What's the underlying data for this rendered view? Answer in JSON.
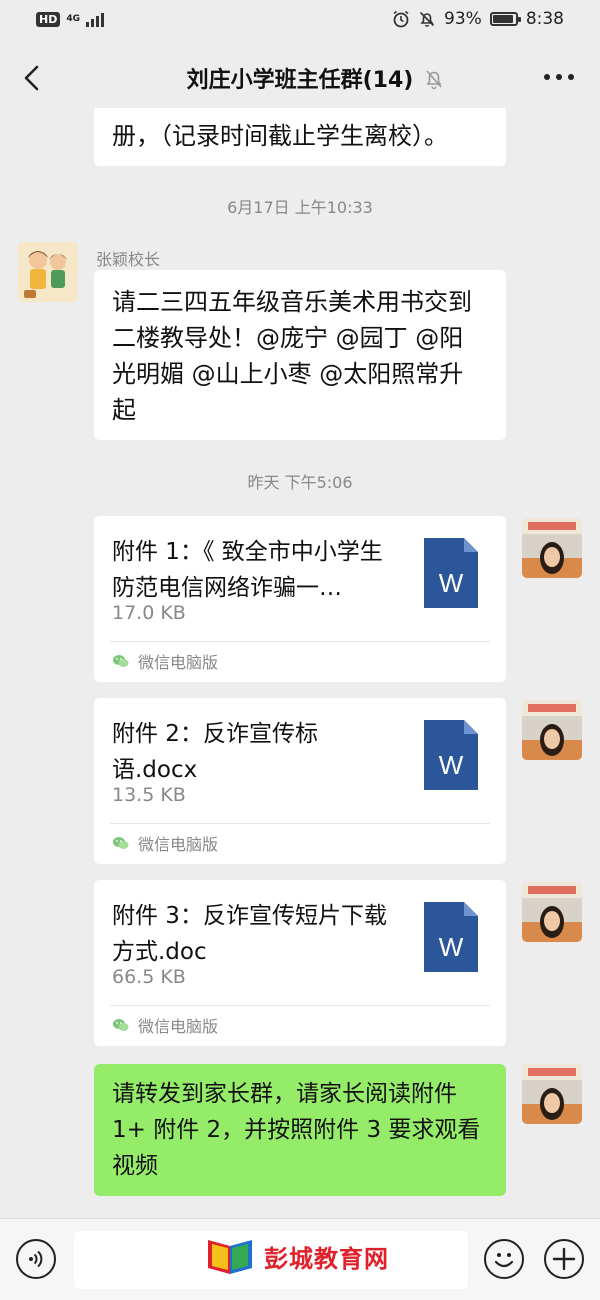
{
  "status_bar": {
    "hd_label": "HD",
    "network_label": "4G",
    "battery": "93%",
    "battery_level": 0.93,
    "time": "8:38",
    "icons": [
      "alarm-icon",
      "do-not-disturb-icon",
      "battery-icon",
      "signal-icon"
    ]
  },
  "header": {
    "title": "刘庄小学班主任群(14)",
    "back_icon": "chevron-left-icon",
    "mute_icon": "bell-off-icon",
    "more_icon": "more-dots-icon"
  },
  "messages": {
    "prev_tail": "册，（记录时间截止学生离校）。",
    "time1": "6月17日 上午10:33",
    "sender1": "张颖校长",
    "msg1_lines": [
      "请二三四五年级音乐美术用书交到",
      "二楼教导处！@庞宁 @园丁 @阳",
      "光明媚 @山上小枣 @太阳照常升",
      "起"
    ],
    "time2": "昨天 下午5:06",
    "files": [
      {
        "name": "附件 1：《 致全市中小学生防范电信网络诈骗一…",
        "size": "17.0 KB",
        "source": "微信电脑版",
        "icon_label": "W"
      },
      {
        "name": "附件 2：反诈宣传标语.docx",
        "size": "13.5 KB",
        "source": "微信电脑版",
        "icon_label": "W"
      },
      {
        "name": "附件 3：反诈宣传短片下载方式.doc",
        "size": "66.5 KB",
        "source": "微信电脑版",
        "icon_label": "W"
      }
    ],
    "last_msg_lines": [
      "请转发到家长群，请家长阅读附件",
      "1+ 附件 2，并按照附件 3 要求观看",
      "视频"
    ]
  },
  "input_bar": {
    "voice_icon": "voice-icon",
    "emoji_icon": "emoji-icon",
    "plus_icon": "plus-icon",
    "watermark": "彭城教育网"
  },
  "colors": {
    "background": "#ededed",
    "self_bubble": "#95ec69",
    "word_blue": "#2b579a",
    "watermark_red": "#e0212b"
  }
}
